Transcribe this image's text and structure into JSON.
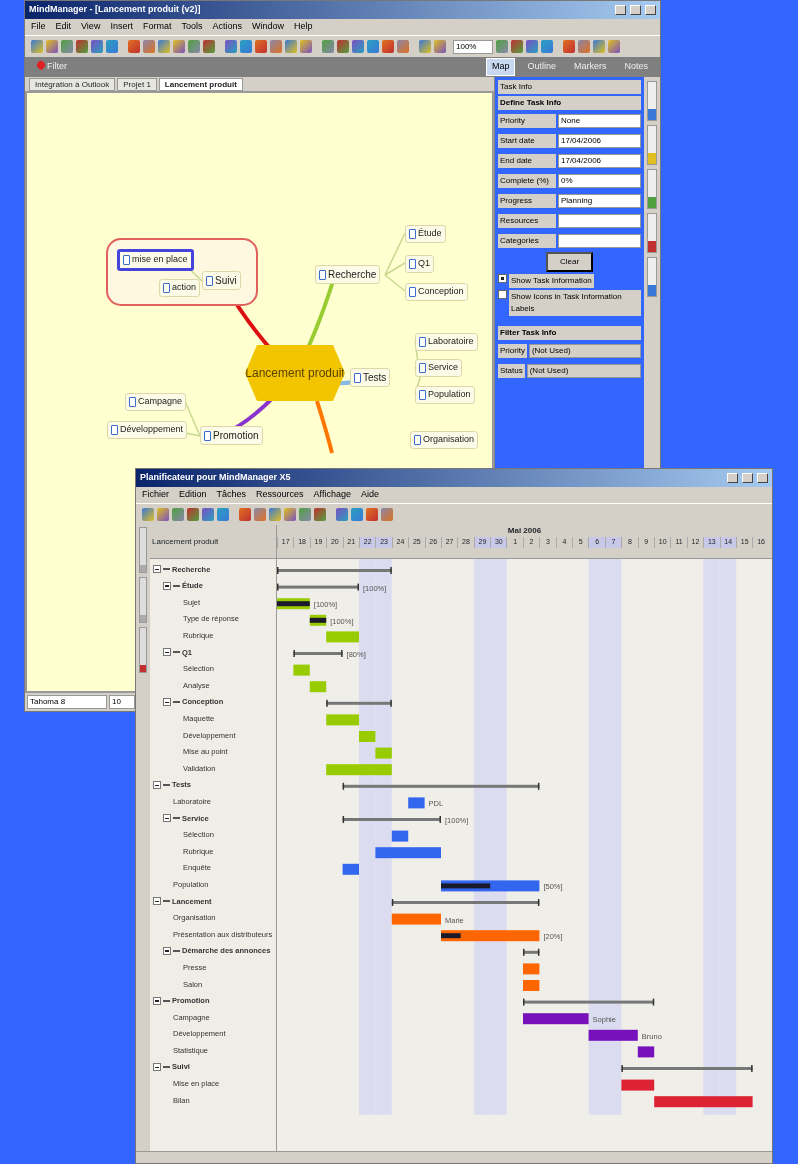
{
  "map_window": {
    "title": "MindManager - [Lancement produit (v2)]",
    "menu": [
      "File",
      "Edit",
      "View",
      "Insert",
      "Format",
      "Tools",
      "Actions",
      "Window",
      "Help"
    ],
    "zoom": "100%",
    "view_bar": {
      "left": [
        {
          "label": "Filter"
        }
      ],
      "right": [
        {
          "label": "Map",
          "selected": true
        },
        {
          "label": "Outline",
          "selected": false
        },
        {
          "label": "Markers",
          "selected": false
        },
        {
          "label": "Notes",
          "selected": false
        }
      ]
    },
    "doc_tabs": [
      {
        "label": "Intégration à Outlook",
        "selected": false
      },
      {
        "label": "Projet 1",
        "selected": false
      },
      {
        "label": "Lancement produit",
        "selected": true
      }
    ],
    "mind_map": {
      "central": "Lancement produit",
      "branches": [
        {
          "label": "Suivi",
          "color": "#dd1111",
          "boundary": true,
          "children": [
            {
              "label": "mise en place",
              "selected": true
            },
            {
              "label": "action",
              "selected": false
            }
          ]
        },
        {
          "label": "Recherche",
          "color": "#99cc33",
          "boundary": false,
          "children": [
            {
              "label": "Étude",
              "selected": false
            },
            {
              "label": "Q1",
              "selected": false
            },
            {
              "label": "Conception",
              "selected": false
            }
          ]
        },
        {
          "label": "Tests",
          "color": "#88b8e8",
          "boundary": false,
          "children": [
            {
              "label": "Laboratoire",
              "selected": false
            },
            {
              "label": "Service",
              "selected": false
            },
            {
              "label": "Population",
              "selected": false
            }
          ]
        },
        {
          "label": "Promotion",
          "color": "#8833cc",
          "boundary": false,
          "children": [
            {
              "label": "Campagne",
              "selected": false
            },
            {
              "label": "Développement",
              "selected": false
            }
          ]
        }
      ],
      "partial_nodes": [
        "Organisation"
      ]
    },
    "font_box": "Tahoma 8",
    "size_box": "10",
    "task_pane": {
      "title": "Task Info",
      "section": "Define Task Info",
      "fields": [
        {
          "label": "Priority",
          "value": "None"
        },
        {
          "label": "Start date",
          "value": "17/04/2006"
        },
        {
          "label": "End date",
          "value": "17/04/2006"
        },
        {
          "label": "Complete (%)",
          "value": "0%"
        },
        {
          "label": "Progress",
          "value": "Planning"
        },
        {
          "label": "Resources"
        },
        {
          "label": "Categories"
        }
      ],
      "clear_button": "Clear",
      "options": [
        {
          "label": "Show Task Information",
          "checked": true
        },
        {
          "label": "Show Icons in Task Information Labels",
          "checked": false
        }
      ],
      "filter_title": "Filter Task Info",
      "filters": [
        {
          "label": "Priority",
          "value": "(Not Used)"
        },
        {
          "label": "Status",
          "value": "(Not Used)"
        }
      ]
    }
  },
  "gantt_window": {
    "title": "Planificateur pour MindManager X5",
    "menu": [
      "Fichier",
      "Edition",
      "Tâches",
      "Ressources",
      "Affichage",
      "Aide"
    ],
    "list_header": "Lancement produit",
    "month": "Mai 2006",
    "days": [
      {
        "label": "17",
        "weekend": false
      },
      {
        "label": "18",
        "weekend": false
      },
      {
        "label": "19",
        "weekend": false
      },
      {
        "label": "20",
        "weekend": false
      },
      {
        "label": "21",
        "weekend": false
      },
      {
        "label": "22",
        "weekend": true
      },
      {
        "label": "23",
        "weekend": true
      },
      {
        "label": "24",
        "weekend": false
      },
      {
        "label": "25",
        "weekend": false
      },
      {
        "label": "26",
        "weekend": false
      },
      {
        "label": "27",
        "weekend": false
      },
      {
        "label": "28",
        "weekend": false
      },
      {
        "label": "29",
        "weekend": true
      },
      {
        "label": "30",
        "weekend": true
      },
      {
        "label": "1",
        "weekend": false
      },
      {
        "label": "2",
        "weekend": false
      },
      {
        "label": "3",
        "weekend": false
      },
      {
        "label": "4",
        "weekend": false
      },
      {
        "label": "5",
        "weekend": false
      },
      {
        "label": "6",
        "weekend": true
      },
      {
        "label": "7",
        "weekend": true
      },
      {
        "label": "8",
        "weekend": false
      },
      {
        "label": "9",
        "weekend": false
      },
      {
        "label": "10",
        "weekend": false
      },
      {
        "label": "11",
        "weekend": false
      },
      {
        "label": "12",
        "weekend": false
      },
      {
        "label": "13",
        "weekend": true
      },
      {
        "label": "14",
        "weekend": true
      },
      {
        "label": "15",
        "weekend": false
      },
      {
        "label": "16",
        "weekend": false
      }
    ],
    "tasks": [
      {
        "name": "Recherche",
        "color": "#99cc00",
        "expanded": true,
        "children": [
          {
            "name": "Étude",
            "expanded": true,
            "note": "[100%]",
            "children": [
              {
                "name": "Sujet",
                "level": 1,
                "note": "[100%]"
              },
              {
                "name": "Type de réponse",
                "level": 1,
                "note": "[100%]"
              },
              {
                "name": "Rubrique"
              }
            ]
          },
          {
            "name": "Q1",
            "expanded": true,
            "note": "[80%]",
            "children": [
              {
                "name": "Sélection"
              },
              {
                "name": "Analyse"
              }
            ]
          },
          {
            "name": "Conception",
            "expanded": true,
            "children": [
              {
                "name": "Maquette"
              },
              {
                "name": "Développement"
              },
              {
                "name": "Mise au point"
              },
              {
                "name": "Validation"
              }
            ]
          }
        ]
      },
      {
        "name": "Tests",
        "color": "#3366ee",
        "expanded": true,
        "children": [
          {
            "name": "Laboratoire",
            "note": "PDL"
          },
          {
            "name": "Service",
            "expanded": true,
            "note": "[100%]",
            "children": [
              {
                "name": "Sélection"
              },
              {
                "name": "Rubrique"
              },
              {
                "name": "Enquête"
              }
            ]
          },
          {
            "name": "Population",
            "level": 0.5,
            "note": "[50%]"
          }
        ]
      },
      {
        "name": "Lancement",
        "color": "#ff6600",
        "expanded": true,
        "children": [
          {
            "name": "Organisation",
            "note": "Marie"
          },
          {
            "name": "Présentation aux distributeurs",
            "level": 0.2,
            "note": "[20%]"
          },
          {
            "name": "Démarche des annonces",
            "expanded": true,
            "children": [
              {
                "name": "Presse"
              },
              {
                "name": "Salon"
              }
            ]
          }
        ]
      },
      {
        "name": "Promotion",
        "color": "#7711bb",
        "expanded": true,
        "children": [
          {
            "name": "Campagne",
            "note": "Sophie"
          },
          {
            "name": "Développement",
            "note": "Bruno"
          },
          {
            "name": "Statistique"
          }
        ]
      },
      {
        "name": "Suivi",
        "color": "#dd2233",
        "expanded": true,
        "children": [
          {
            "name": "Mise en place"
          },
          {
            "name": "Bilan"
          }
        ]
      }
    ]
  }
}
